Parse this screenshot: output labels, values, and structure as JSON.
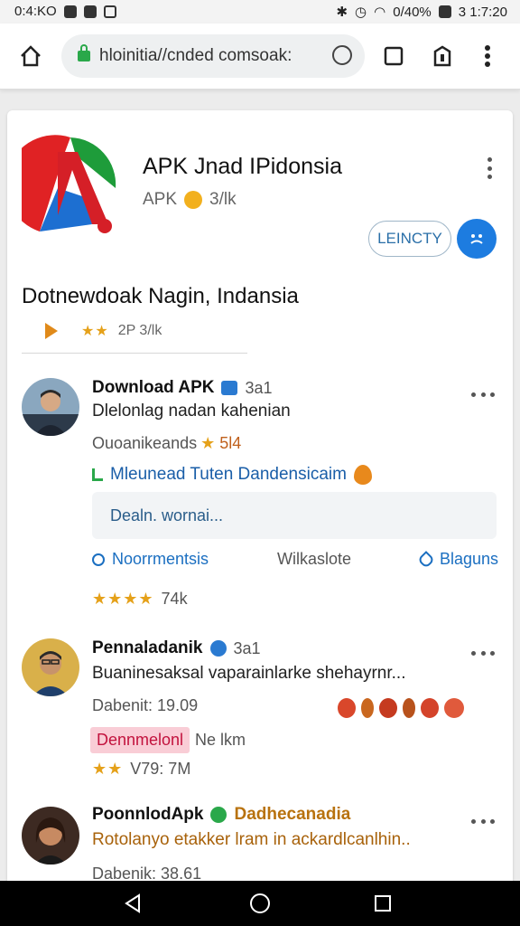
{
  "status_bar": {
    "time": "0:4:KO",
    "battery": "0/40%",
    "clock": "3 1:7:20"
  },
  "browser": {
    "url": "hloinitia//cnded comsoak:"
  },
  "app": {
    "title": "APK  Jnad IPidonsia",
    "subtitle": "APK",
    "subtitle_count": "3/lk",
    "install_label": "LEINCTY"
  },
  "section": {
    "title": "Dotnewdoak Nagin, Indansia",
    "rating_text": "2P 3/lk"
  },
  "posts": [
    {
      "name": "Download APK",
      "time": "3a1",
      "text": "Dlelonlag nadan kahenian",
      "meta": "Ouoanikeands",
      "meta_count": "5l4",
      "link": "Mleunead Tuten Dandensicaim",
      "comment_placeholder": "Dealn. wornai...",
      "actions": [
        "Noorrmentsis",
        "Wilkaslote",
        "Blaguns"
      ],
      "rating": "74k"
    },
    {
      "name": "Pennaladanik",
      "time": "3a1",
      "text": "Buaninesaksal vaparainlarke shehayrnr...",
      "meta": "Dabenit: 19.09",
      "tag": "Dennmelonl",
      "tag_side": "Ne lkm",
      "rating": "V79: 7M"
    },
    {
      "name": "PoonnlodApk",
      "name_extra": "Dadhecanadia",
      "text": "Rotolanyo etakker lram in ackardlcanlhin..",
      "meta": "Dabenik: 38.61"
    }
  ],
  "colors": {
    "accent_blue": "#1d7ce0",
    "link_blue": "#1a5ea8",
    "star": "#e5a11a",
    "tag_bg": "#f9cdd6"
  }
}
